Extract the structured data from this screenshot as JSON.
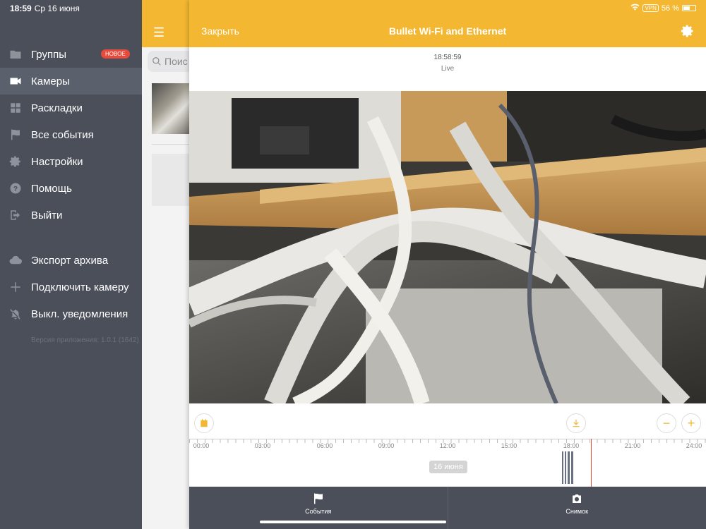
{
  "status_bar": {
    "time": "18:59",
    "date": "Ср 16 июня",
    "vpn": "VPN",
    "battery": "56 %"
  },
  "sidebar": {
    "items": [
      {
        "label": "Группы",
        "icon": "folder-icon",
        "badge": "НОВОЕ"
      },
      {
        "label": "Камеры",
        "icon": "video-camera-icon",
        "active": true
      },
      {
        "label": "Раскладки",
        "icon": "grid-icon"
      },
      {
        "label": "Все события",
        "icon": "flag-icon"
      },
      {
        "label": "Настройки",
        "icon": "gear-icon"
      },
      {
        "label": "Помощь",
        "icon": "help-icon"
      },
      {
        "label": "Выйти",
        "icon": "logout-icon"
      }
    ],
    "items2": [
      {
        "label": "Экспорт архива",
        "icon": "cloud-download-icon"
      },
      {
        "label": "Подключить камеру",
        "icon": "plus-icon"
      },
      {
        "label": "Выкл. уведомления",
        "icon": "bell-off-icon"
      }
    ],
    "version": "Версия приложения: 1.0.1 (1642)"
  },
  "list_panel": {
    "search_placeholder": "Поис"
  },
  "header": {
    "close_label": "Закрыть",
    "title": "Bullet Wi-Fi and Ethernet"
  },
  "player": {
    "clock": "18:58:59",
    "mode": "Live"
  },
  "timeline": {
    "ticks": [
      "00:00",
      "03:00",
      "06:00",
      "09:00",
      "12:00",
      "15:00",
      "18:00",
      "21:00",
      "24:00"
    ],
    "date_label": "16 июня",
    "current_time_fraction": 0.7906
  },
  "tabs": {
    "events_label": "События",
    "snapshot_label": "Снимок"
  },
  "colors": {
    "accent": "#f4b731",
    "sidebar_bg": "#4a4f5a",
    "alert": "#e84a3b"
  }
}
